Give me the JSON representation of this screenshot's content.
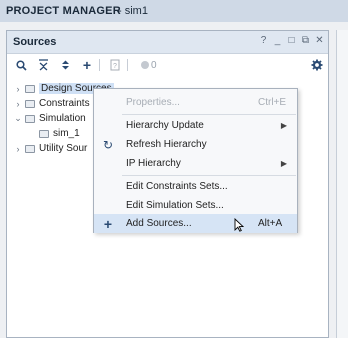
{
  "app": {
    "title": "PROJECT MANAGER",
    "subtitle": "- sim1"
  },
  "panel": {
    "title": "Sources",
    "header_controls": [
      "?",
      "_",
      "□",
      "⧉",
      "✕"
    ]
  },
  "toolbar": {
    "count": "0"
  },
  "tree": {
    "items": [
      {
        "label": "Design Sources",
        "expanded": false,
        "selected": true
      },
      {
        "label": "Constraints",
        "expanded": false
      },
      {
        "label": "Simulation",
        "expanded": true
      },
      {
        "label": "sim_1",
        "child": true
      },
      {
        "label": "Utility Sour",
        "expanded": false
      }
    ]
  },
  "context_menu": {
    "items": [
      {
        "label": "Properties...",
        "shortcut": "Ctrl+E",
        "disabled": true
      },
      {
        "label": "Hierarchy Update",
        "submenu": true
      },
      {
        "label": "Refresh Hierarchy",
        "icon": "refresh-icon"
      },
      {
        "label": "IP Hierarchy",
        "submenu": true
      },
      {
        "label": "Edit Constraints Sets..."
      },
      {
        "label": "Edit Simulation Sets..."
      },
      {
        "label": "Add Sources...",
        "shortcut": "Alt+A",
        "icon": "plus-icon",
        "highlighted": true
      }
    ]
  },
  "colors": {
    "accent": "#2a4a72",
    "selection": "#cfe0f5",
    "menu_hover": "#d6e4f5"
  }
}
